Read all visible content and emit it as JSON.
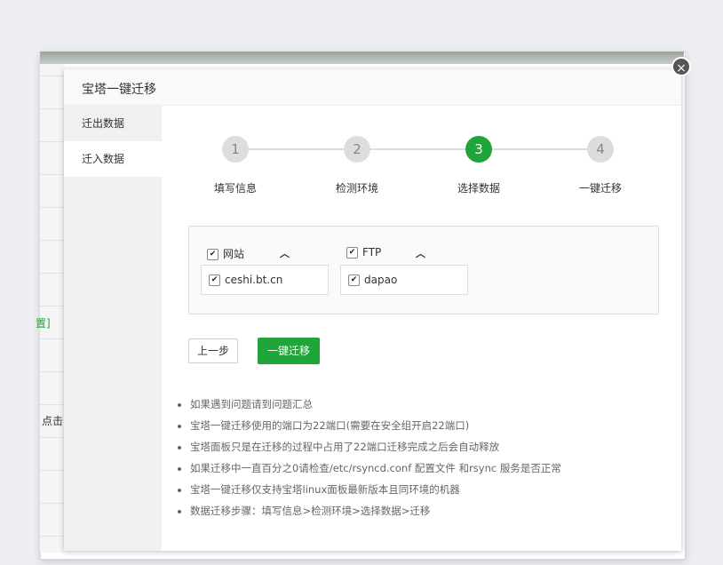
{
  "background": {
    "fragment_1": "置]",
    "fragment_2": "点击"
  },
  "dialog": {
    "title": "宝塔一键迁移",
    "close_icon": "close-icon"
  },
  "sidebar": {
    "items": [
      {
        "label": "迁出数据",
        "active": false
      },
      {
        "label": "迁入数据",
        "active": true
      }
    ]
  },
  "steps": [
    {
      "number": "1",
      "label": "填写信息",
      "active": false
    },
    {
      "number": "2",
      "label": "检测环境",
      "active": false
    },
    {
      "number": "3",
      "label": "选择数据",
      "active": true
    },
    {
      "number": "4",
      "label": "一键迁移",
      "active": false
    }
  ],
  "selection": {
    "groups": [
      {
        "label": "网站",
        "checked": true,
        "expanded": true,
        "items": [
          {
            "label": "ceshi.bt.cn",
            "checked": true
          }
        ]
      },
      {
        "label": "FTP",
        "checked": true,
        "expanded": true,
        "items": [
          {
            "label": "dapao",
            "checked": true
          }
        ]
      }
    ]
  },
  "buttons": {
    "prev": "上一步",
    "migrate": "一键迁移"
  },
  "tips": [
    "如果遇到问题请到问题汇总",
    "宝塔一键迁移使用的端口为22端口(需要在安全组开启22端口)",
    "宝塔面板只是在迁移的过程中占用了22端口迁移完成之后会自动释放",
    "如果迁移中一直百分之0请检查/etc/rsyncd.conf 配置文件 和rsync 服务是否正常",
    "宝塔一键迁移仅支持宝塔linux面板最新版本且同环境的机器",
    "数据迁移步骤：填写信息>检测环境>选择数据>迁移"
  ],
  "colors": {
    "accent": "#20a53a",
    "step_inactive": "#dddddd"
  }
}
